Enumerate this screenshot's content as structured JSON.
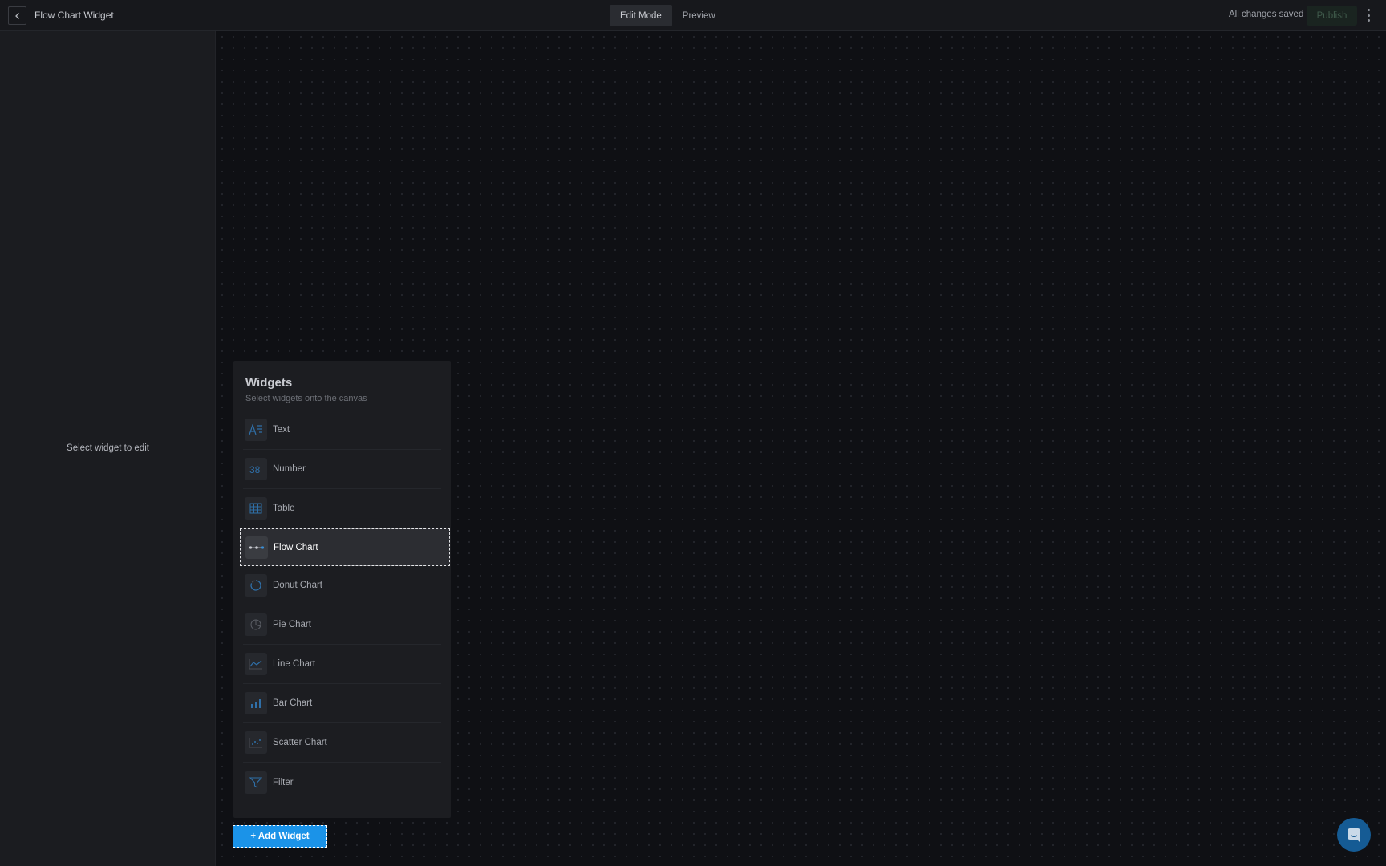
{
  "header": {
    "title": "Flow Chart Widget",
    "modes": [
      {
        "label": "Edit Mode",
        "active": true
      },
      {
        "label": "Preview",
        "active": false
      }
    ],
    "save_status": "All changes saved",
    "publish_label": "Publish"
  },
  "left_panel": {
    "hint": "Select widget to edit"
  },
  "picker": {
    "title": "Widgets",
    "subtitle": "Select widgets onto the canvas",
    "items": [
      {
        "label": "Text",
        "icon": "text-icon"
      },
      {
        "label": "Number",
        "icon": "number-icon"
      },
      {
        "label": "Table",
        "icon": "table-icon"
      },
      {
        "label": "Flow Chart",
        "icon": "flow-chart-icon",
        "selected": true
      },
      {
        "label": "Donut Chart",
        "icon": "donut-chart-icon"
      },
      {
        "label": "Pie Chart",
        "icon": "pie-chart-icon"
      },
      {
        "label": "Line Chart",
        "icon": "line-chart-icon"
      },
      {
        "label": "Bar Chart",
        "icon": "bar-chart-icon"
      },
      {
        "label": "Scatter Chart",
        "icon": "scatter-chart-icon"
      },
      {
        "label": "Filter",
        "icon": "filter-icon"
      }
    ]
  },
  "add_widget_label": "+ Add Widget",
  "colors": {
    "accent": "#1b93e8",
    "icon_blue": "#2f6fa8",
    "background": "#0f1014"
  }
}
